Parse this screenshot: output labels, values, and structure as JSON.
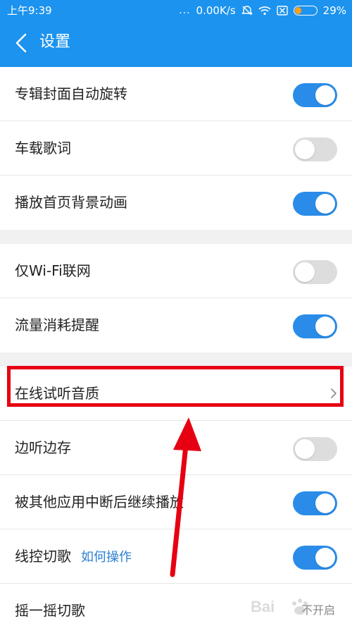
{
  "status_bar": {
    "time": "上午9:39",
    "dots": "...",
    "network_speed": "0.00K/s",
    "battery_percent": "29%",
    "battery_level": 0.29
  },
  "header": {
    "title": "设置"
  },
  "settings": {
    "album_cover_rotate": {
      "label": "专辑封面自动旋转",
      "on": true
    },
    "car_lyrics": {
      "label": "车载歌词",
      "on": false
    },
    "home_bg_animation": {
      "label": "播放首页背景动画",
      "on": true
    },
    "wifi_only": {
      "label": "仅Wi-Fi联网",
      "on": false
    },
    "data_usage_reminder": {
      "label": "流量消耗提醒",
      "on": true
    },
    "online_audio_quality": {
      "label": "在线试听音质"
    },
    "cache_while_listening": {
      "label": "边听边存",
      "on": false
    },
    "resume_after_interrupt": {
      "label": "被其他应用中断后继续播放",
      "on": true
    },
    "wire_control": {
      "label": "线控切歌",
      "link": "如何操作",
      "on": true
    },
    "shake_switch": {
      "label": "摇一摇切歌",
      "value": "不开启"
    }
  },
  "colors": {
    "brand_blue": "#1c93ee",
    "toggle_on": "#2a8ce8",
    "toggle_off": "#dddddd",
    "annotation_red": "#e60012"
  },
  "watermark": "Bai"
}
